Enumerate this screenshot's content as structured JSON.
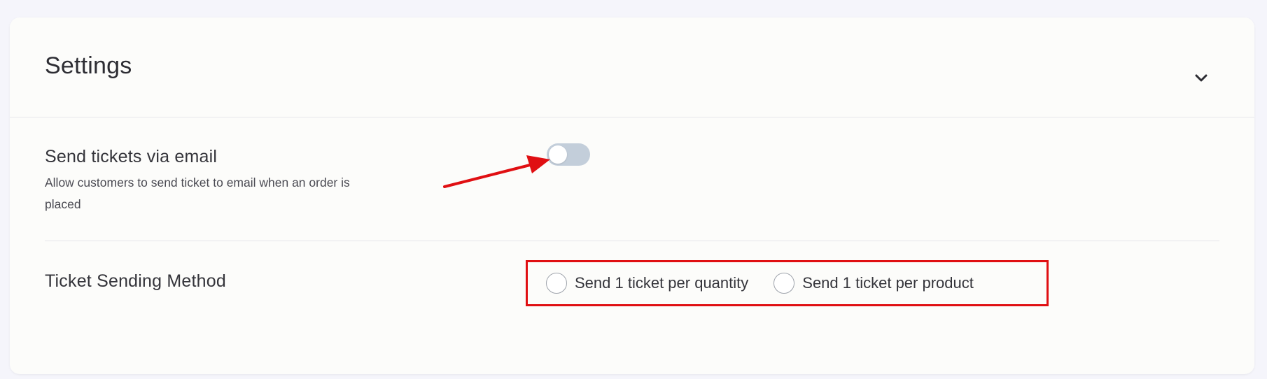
{
  "header": {
    "title": "Settings",
    "collapse_icon": "chevron-down-icon"
  },
  "email_setting": {
    "label": "Send tickets via email",
    "description": "Allow customers to send ticket to email when an order is placed",
    "toggle_on": false
  },
  "sending_method": {
    "label": "Ticket Sending Method",
    "options": [
      {
        "label": "Send 1 ticket per quantity",
        "selected": false
      },
      {
        "label": "Send 1 ticket per product",
        "selected": false
      }
    ]
  },
  "colors": {
    "annotation": "#e00f12",
    "toggle_off": "#c3ceda",
    "card_background": "#fcfcfa",
    "page_background": "#f5f5fb"
  }
}
